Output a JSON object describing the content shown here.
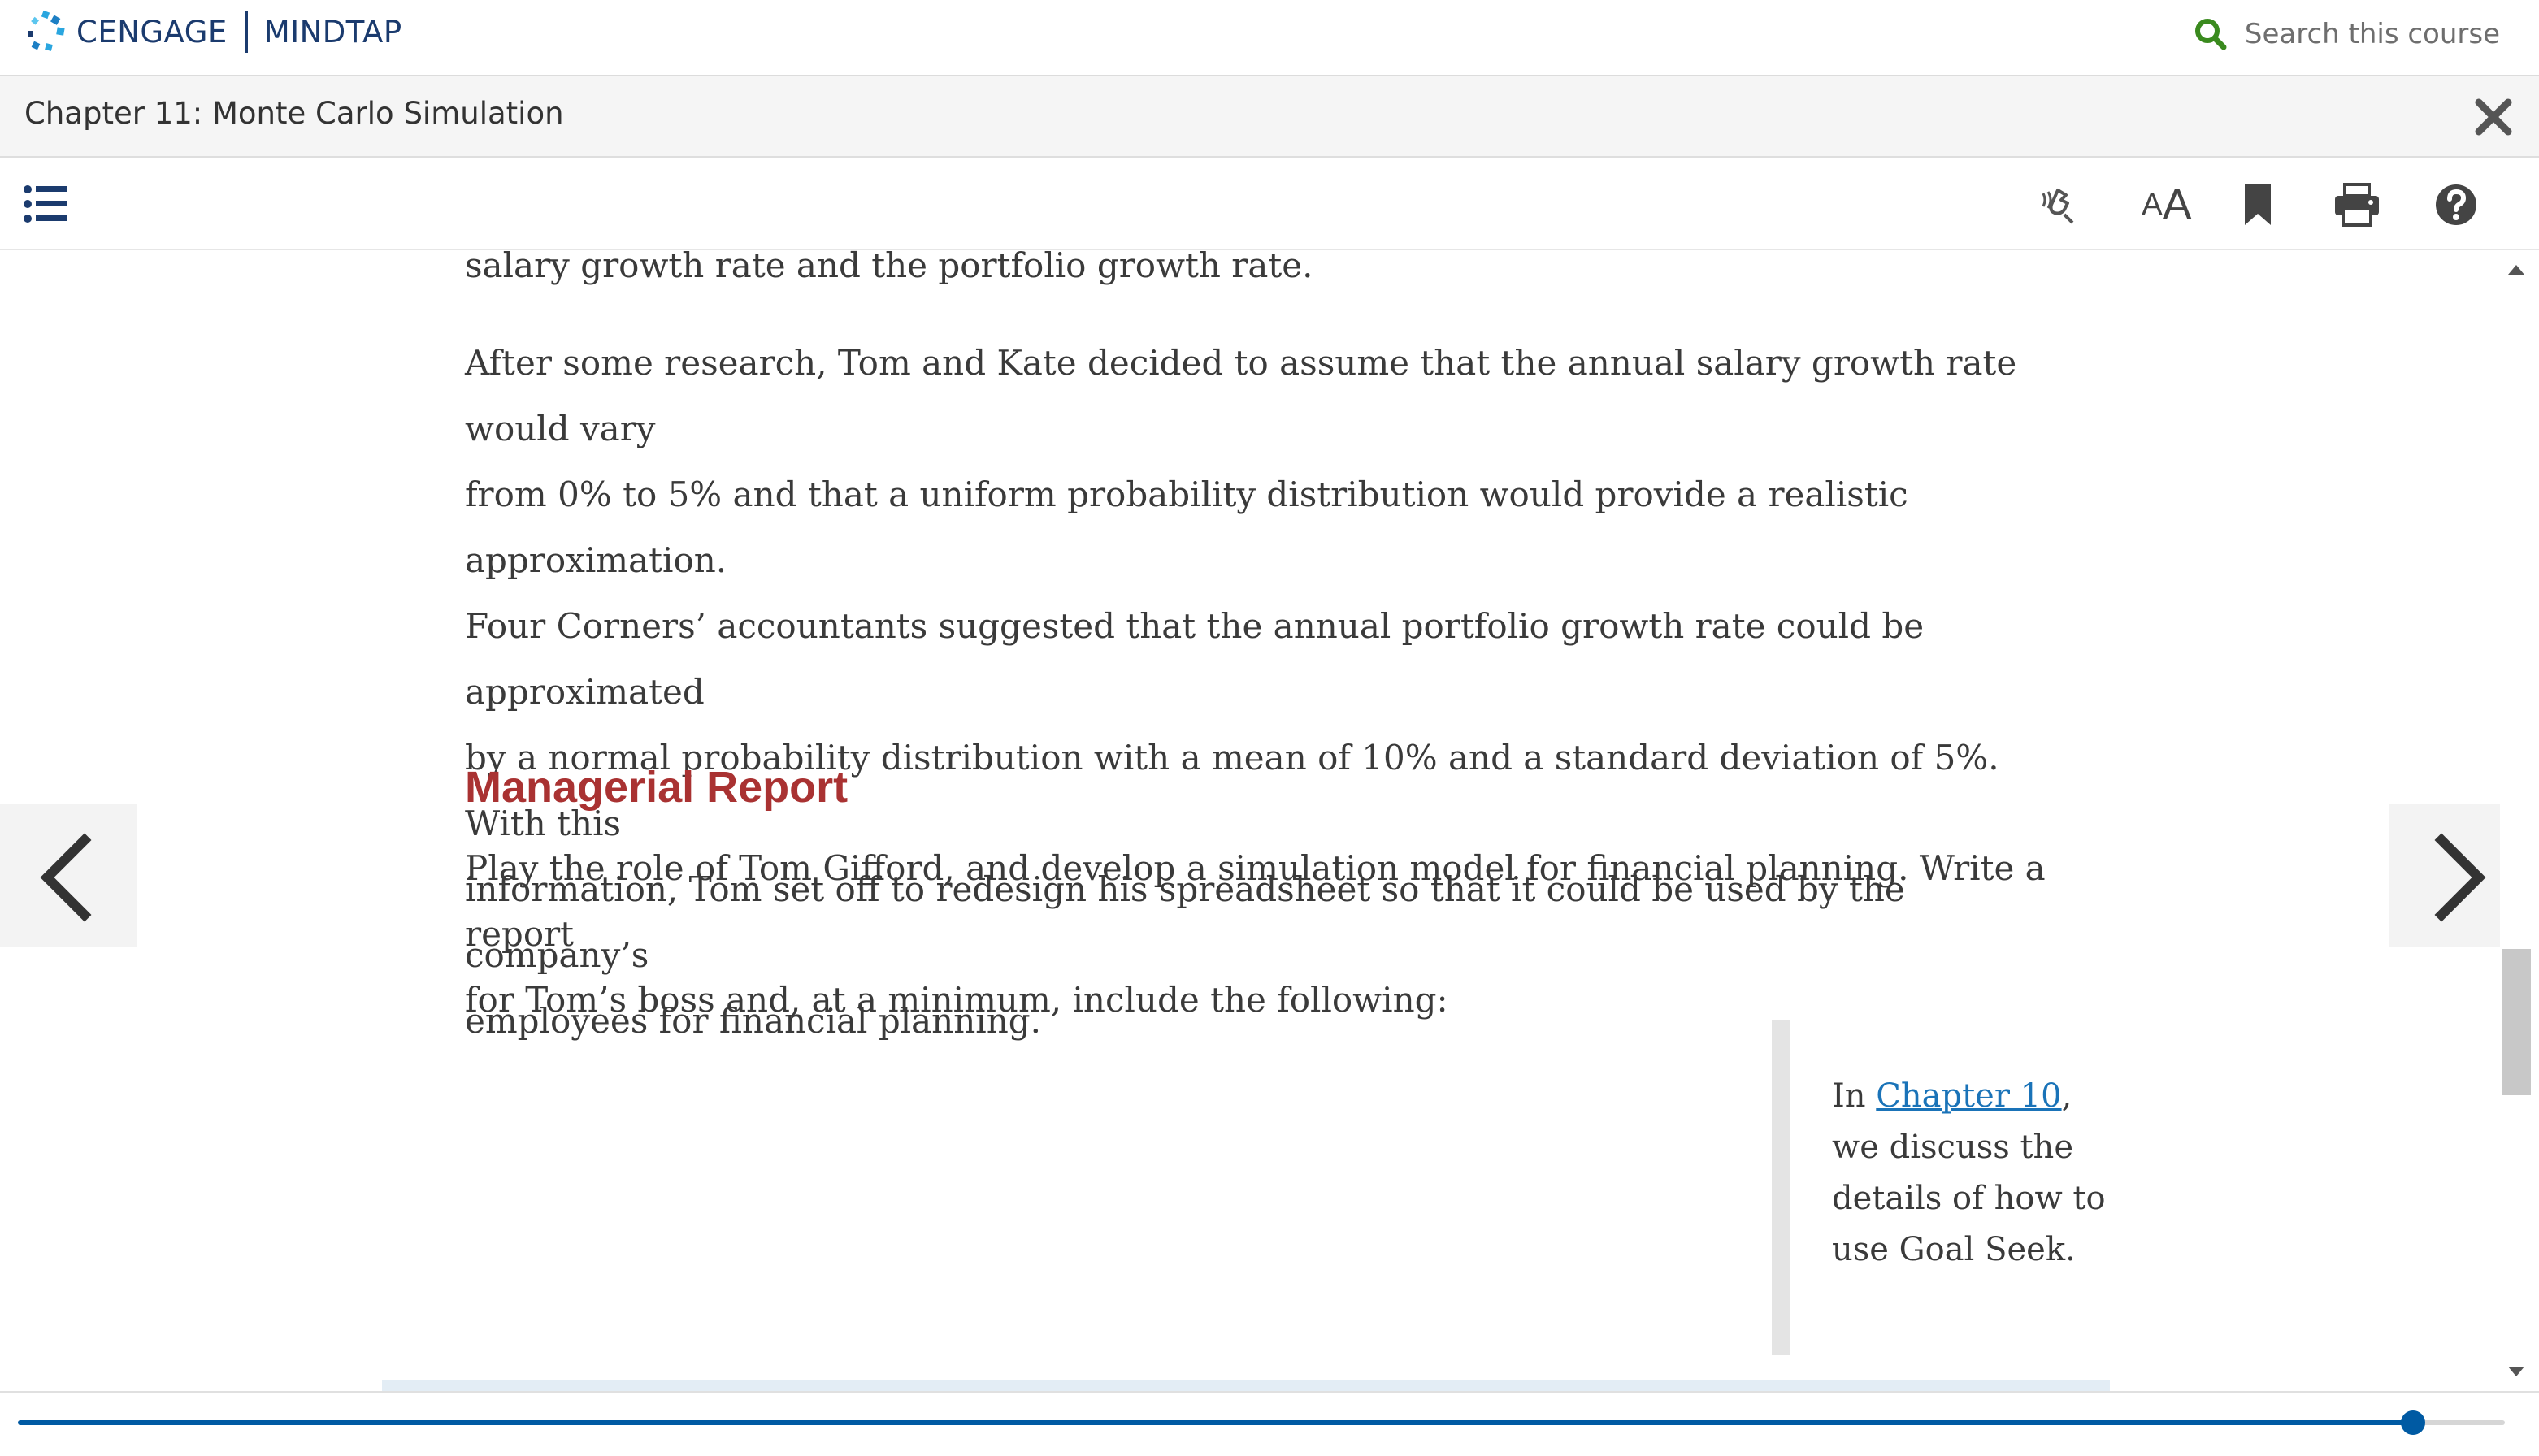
{
  "header": {
    "brand_left": "CENGAGE",
    "brand_right": "MINDTAP",
    "search_placeholder": "Search this course"
  },
  "titlebar": {
    "chapter_title": "Chapter 11: Monte Carlo Simulation"
  },
  "toolbar": {
    "icons": [
      "list-icon",
      "read-aloud-icon",
      "text-size-icon",
      "bookmark-icon",
      "print-icon",
      "help-icon"
    ],
    "text_size_small": "A",
    "text_size_large": "A"
  },
  "content": {
    "para0": "salary growth rate and the portfolio growth rate.",
    "para1_lines": [
      "After some research, Tom and Kate decided to assume that the annual salary growth rate would vary",
      "from 0% to 5% and that a uniform probability distribution would provide a realistic approximation.",
      "Four Corners’ accountants suggested that the annual portfolio growth rate could be approximated",
      "by a normal probability distribution with a mean of 10% and a standard deviation of 5%. With this",
      "information, Tom set off to redesign his spreadsheet so that it could be used by the company’s",
      "employees for financial planning."
    ],
    "heading": "Managerial Report",
    "para2_lines": [
      "Play the role of Tom Gifford, and develop a simulation model for financial planning. Write a report",
      "for Tom’s boss and, at a minimum, include the following:"
    ],
    "sidebar": {
      "prefix": "In ",
      "link": "Chapter 10",
      "suffix": ",",
      "rest_lines": [
        "we discuss the",
        "details of how to",
        "use Goal Seek."
      ]
    }
  },
  "progress": {
    "fraction": 0.963
  },
  "colors": {
    "brand_blue": "#1b3b6e",
    "heading_red": "#a93232",
    "link_blue": "#1a73b8",
    "progress_blue": "#005aa3",
    "search_green": "#3a8a1e"
  }
}
